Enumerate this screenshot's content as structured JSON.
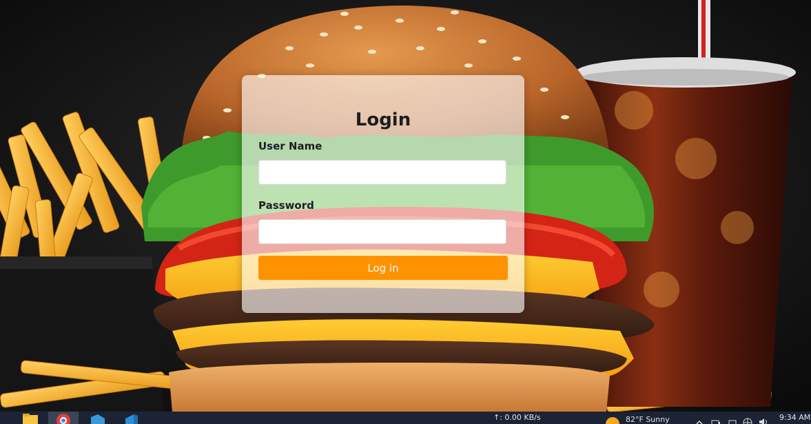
{
  "login": {
    "title": "Login",
    "username_label": "User Name",
    "username_value": "",
    "password_label": "Password",
    "password_value": "",
    "submit_label": "Log in"
  },
  "colors": {
    "accent": "#ff9200",
    "card": "rgba(255,255,255,0.62)",
    "taskbar": "#1b2334"
  },
  "taskbar": {
    "pinned": [
      "file-explorer-icon",
      "chrome-icon",
      "visual-studio-icon",
      "vscode-icon"
    ],
    "net_speed": "↑: 0.00 KB/s",
    "weather_text": "82°F  Sunny",
    "time": "9:34 AM"
  },
  "background": {
    "subject": "burger-fries-soda-photo"
  }
}
